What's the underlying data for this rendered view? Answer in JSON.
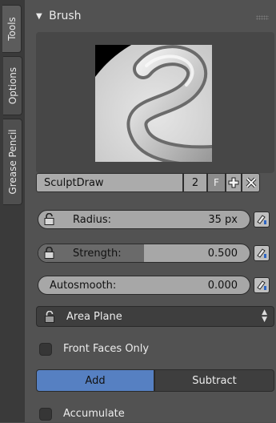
{
  "tabs": [
    {
      "label": "Tools",
      "active": true
    },
    {
      "label": "Options",
      "active": false
    },
    {
      "label": "Grease Pencil",
      "active": false
    }
  ],
  "panel": {
    "header": "Brush",
    "brush": {
      "name": "SculptDraw",
      "users": "2",
      "fake_user": "F"
    },
    "radius": {
      "label": "Radius:",
      "value": "35 px",
      "fill_fraction": 0.0
    },
    "strength": {
      "label": "Strength:",
      "value": "0.500",
      "fill_fraction": 0.5
    },
    "autosmooth": {
      "label": "Autosmooth:",
      "value": "0.000",
      "fill_fraction": 0.0
    },
    "sculpt_plane": {
      "label": "Area Plane"
    },
    "front_faces_only": {
      "label": "Front Faces Only",
      "checked": false
    },
    "direction": {
      "add": "Add",
      "subtract": "Subtract",
      "selected": "Add"
    },
    "accumulate": {
      "label": "Accumulate",
      "checked": false
    }
  },
  "colors": {
    "accent": "#5680c2",
    "panel_bg": "#525252",
    "field_bg": "#a7a7a7"
  }
}
